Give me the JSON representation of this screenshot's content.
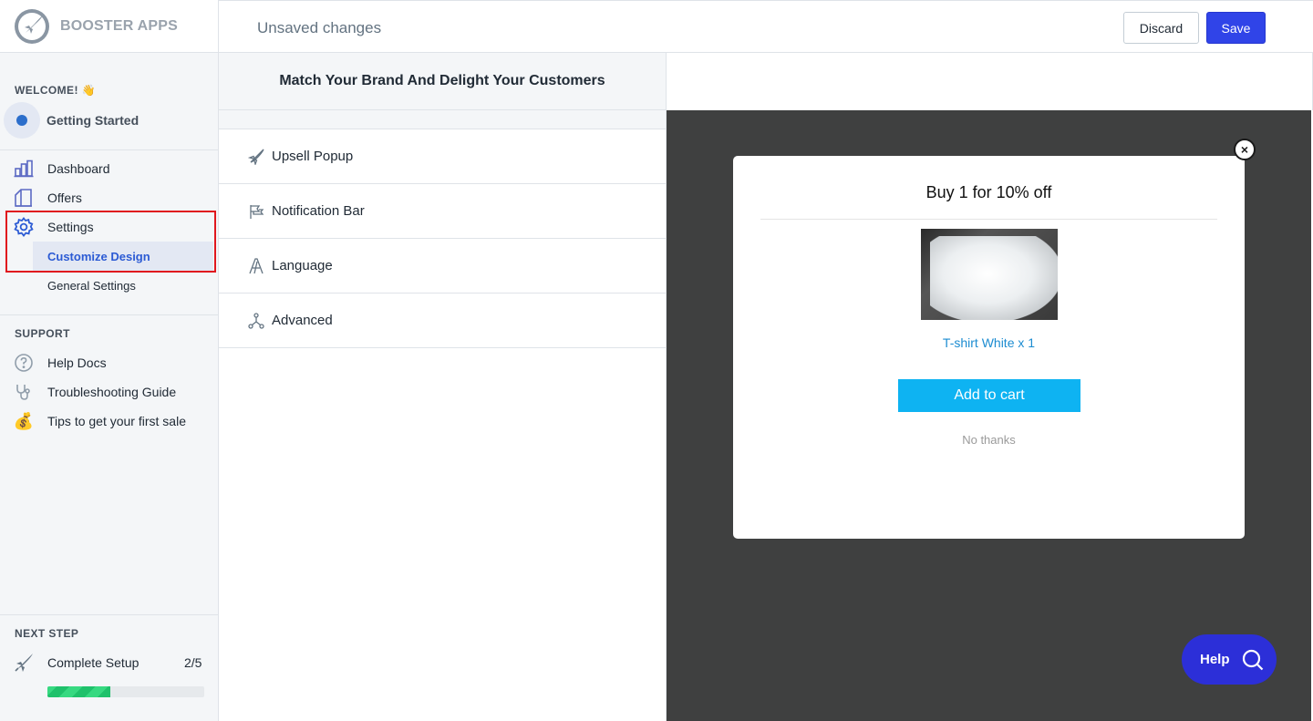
{
  "brand": {
    "name": "BOOSTER APPS"
  },
  "topbar": {
    "status": "Unsaved changes",
    "discard_label": "Discard",
    "save_label": "Save"
  },
  "sidebar": {
    "welcome": "WELCOME! 👋",
    "getting_started": "Getting Started",
    "nav": [
      {
        "label": "Dashboard",
        "icon": "bar-chart-icon"
      },
      {
        "label": "Offers",
        "icon": "offers-icon"
      },
      {
        "label": "Settings",
        "icon": "gear-icon"
      }
    ],
    "settings_sub": [
      {
        "label": "Customize Design",
        "active": true
      },
      {
        "label": "General Settings",
        "active": false
      }
    ],
    "support_title": "SUPPORT",
    "support": [
      {
        "label": "Help Docs",
        "icon": "question-circle-icon"
      },
      {
        "label": "Troubleshooting Guide",
        "icon": "stethoscope-icon"
      },
      {
        "label": "Tips to get your first sale",
        "icon": "money-bag-icon"
      }
    ],
    "next_step_title": "NEXT STEP",
    "next_step": {
      "label": "Complete Setup",
      "progress_text": "2/5",
      "progress": 0.4
    }
  },
  "design_panel": {
    "header": "Match Your Brand And Delight Your Customers",
    "items": [
      {
        "label": "Upsell Popup",
        "icon": "rocket-outline-icon"
      },
      {
        "label": "Notification Bar",
        "icon": "flag-icon"
      },
      {
        "label": "Language",
        "icon": "font-icon"
      },
      {
        "label": "Advanced",
        "icon": "network-icon"
      }
    ]
  },
  "preview": {
    "title": "Buy 1 for 10% off",
    "product_name": "T-shirt White x 1",
    "add_to_cart": "Add to cart",
    "no_thanks": "No thanks",
    "close_symbol": "×"
  },
  "help_widget": {
    "label": "Help"
  },
  "colors": {
    "accent": "#3044e8",
    "cart_button": "#0eb3f2",
    "highlight": "#e0171e",
    "preview_bg": "#3f4040"
  }
}
